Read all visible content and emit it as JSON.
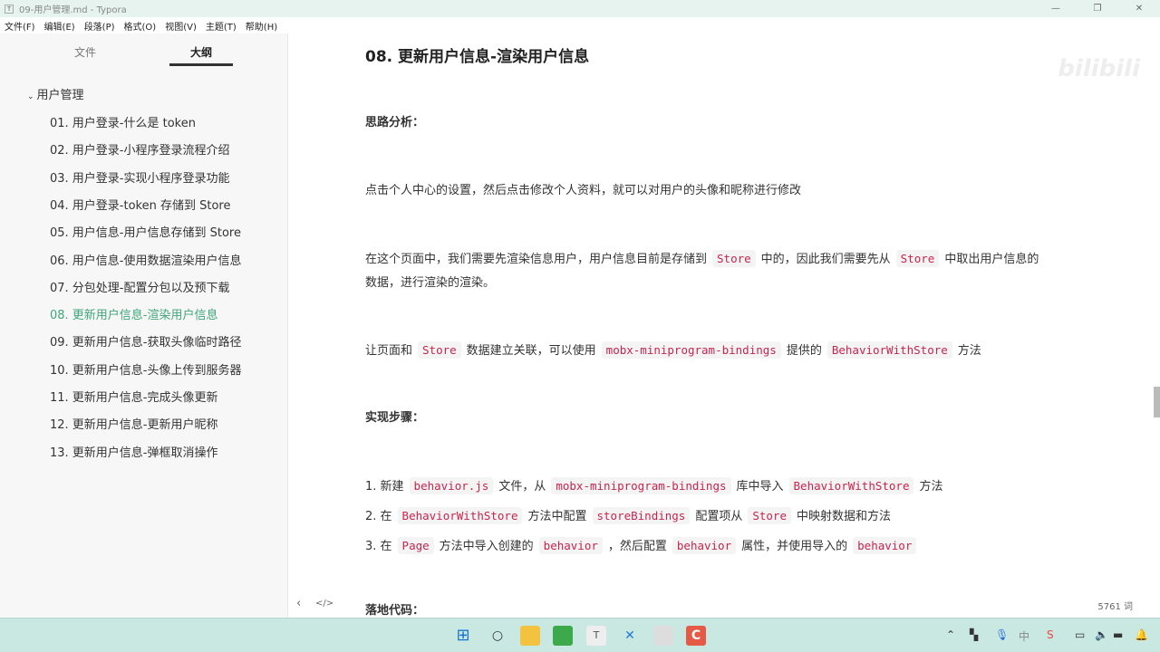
{
  "window": {
    "title": "09-用户管理.md - Typora",
    "app_icon": "T"
  },
  "menu": [
    "文件(F)",
    "编辑(E)",
    "段落(P)",
    "格式(O)",
    "视图(V)",
    "主题(T)",
    "帮助(H)"
  ],
  "sidebar": {
    "tabs": [
      "文件",
      "大纲"
    ],
    "active_tab": 1,
    "root": "用户管理",
    "items": [
      "01. 用户登录-什么是 token",
      "02. 用户登录-小程序登录流程介绍",
      "03. 用户登录-实现小程序登录功能",
      "04. 用户登录-token 存储到 Store",
      "05. 用户信息-用户信息存储到 Store",
      "06. 用户信息-使用数据渲染用户信息",
      "07. 分包处理-配置分包以及预下载",
      "08. 更新用户信息-渲染用户信息",
      "09. 更新用户信息-获取头像临时路径",
      "10. 更新用户信息-头像上传到服务器",
      "11. 更新用户信息-完成头像更新",
      "12. 更新用户信息-更新用户昵称",
      "13. 更新用户信息-弹框取消操作"
    ],
    "active_item": 7
  },
  "content": {
    "heading": "08. 更新用户信息-渲染用户信息",
    "paragraphs": [
      [
        {
          "t": "思路分析：",
          "b": true
        }
      ],
      [
        {
          "t": "点击个人中心的设置，然后点击修改个人资料，就可以对用户的头像和昵称进行修改"
        }
      ],
      [
        {
          "t": "在这个页面中，我们需要先渲染信息用户，用户信息目前是存储到"
        },
        {
          "t": "Store",
          "c": true
        },
        {
          "t": "中的，因此我们需要先从"
        },
        {
          "t": "Store",
          "c": true
        },
        {
          "t": "中取出用户信息的"
        }
      ],
      [
        {
          "t": "数据，进行渲染的渲染。"
        }
      ],
      [
        {
          "t": "让页面和"
        },
        {
          "t": "Store",
          "c": true
        },
        {
          "t": "数据建立关联，可以使用"
        },
        {
          "t": "mobx-miniprogram-bindings",
          "c": true
        },
        {
          "t": "提供的"
        },
        {
          "t": "BehaviorWithStore",
          "c": true
        },
        {
          "t": "方法"
        }
      ],
      [
        {
          "t": "实现步骤：",
          "b": true
        }
      ],
      [
        {
          "t": "1. 新建"
        },
        {
          "t": "behavior.js",
          "c": true
        },
        {
          "t": "文件，从"
        },
        {
          "t": "mobx-miniprogram-bindings",
          "c": true
        },
        {
          "t": "库中导入"
        },
        {
          "t": "BehaviorWithStore",
          "c": true
        },
        {
          "t": "方法"
        }
      ],
      [
        {
          "t": "2. 在"
        },
        {
          "t": "BehaviorWithStore",
          "c": true
        },
        {
          "t": "方法中配置"
        },
        {
          "t": "storeBindings",
          "c": true
        },
        {
          "t": "配置项从"
        },
        {
          "t": "Store",
          "c": true
        },
        {
          "t": "中映射数据和方法"
        }
      ],
      [
        {
          "t": "3. 在"
        },
        {
          "t": "Page",
          "c": true
        },
        {
          "t": "方法中导入创建的"
        },
        {
          "t": "behavior",
          "c": true
        },
        {
          "t": "，然后配置"
        },
        {
          "t": "behavior",
          "c": true
        },
        {
          "t": "属性，并使用导入的"
        },
        {
          "t": "behavior",
          "c": true
        }
      ],
      [
        {
          "t": "落地代码：",
          "b": true
        }
      ]
    ]
  },
  "status": {
    "word_count": "5761 词",
    "back_icon": "‹",
    "source_icon": "</>"
  },
  "watermark": "bilibili"
}
